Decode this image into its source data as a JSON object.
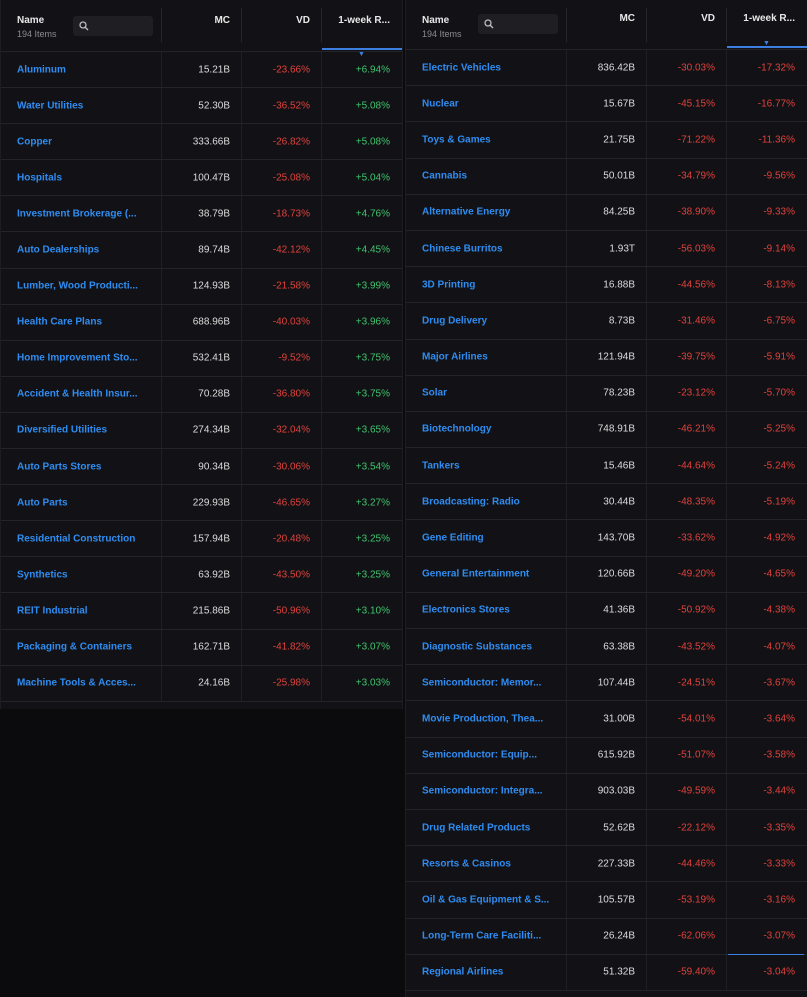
{
  "colors": {
    "accent": "#3d7fe0",
    "positive": "#3ec46d",
    "negative": "#e0413c",
    "link": "#2f8cf0"
  },
  "left": {
    "header": {
      "name": "Name",
      "count": "194 Items",
      "mc": "MC",
      "vd": "VD",
      "week": "1-week R..."
    },
    "rows": [
      {
        "name": "Aluminum",
        "mc": "15.21B",
        "vd": "-23.66%",
        "wk": "+6.94%"
      },
      {
        "name": "Water Utilities",
        "mc": "52.30B",
        "vd": "-36.52%",
        "wk": "+5.08%"
      },
      {
        "name": "Copper",
        "mc": "333.66B",
        "vd": "-26.82%",
        "wk": "+5.08%"
      },
      {
        "name": "Hospitals",
        "mc": "100.47B",
        "vd": "-25.08%",
        "wk": "+5.04%"
      },
      {
        "name": "Investment Brokerage (...",
        "mc": "38.79B",
        "vd": "-18.73%",
        "wk": "+4.76%"
      },
      {
        "name": "Auto Dealerships",
        "mc": "89.74B",
        "vd": "-42.12%",
        "wk": "+4.45%"
      },
      {
        "name": "Lumber, Wood Producti...",
        "mc": "124.93B",
        "vd": "-21.58%",
        "wk": "+3.99%"
      },
      {
        "name": "Health Care Plans",
        "mc": "688.96B",
        "vd": "-40.03%",
        "wk": "+3.96%"
      },
      {
        "name": "Home Improvement Sto...",
        "mc": "532.41B",
        "vd": "-9.52%",
        "wk": "+3.75%"
      },
      {
        "name": "Accident & Health Insur...",
        "mc": "70.28B",
        "vd": "-36.80%",
        "wk": "+3.75%"
      },
      {
        "name": "Diversified Utilities",
        "mc": "274.34B",
        "vd": "-32.04%",
        "wk": "+3.65%"
      },
      {
        "name": "Auto Parts Stores",
        "mc": "90.34B",
        "vd": "-30.06%",
        "wk": "+3.54%"
      },
      {
        "name": "Auto Parts",
        "mc": "229.93B",
        "vd": "-46.65%",
        "wk": "+3.27%"
      },
      {
        "name": "Residential Construction",
        "mc": "157.94B",
        "vd": "-20.48%",
        "wk": "+3.25%"
      },
      {
        "name": "Synthetics",
        "mc": "63.92B",
        "vd": "-43.50%",
        "wk": "+3.25%"
      },
      {
        "name": "REIT Industrial",
        "mc": "215.86B",
        "vd": "-50.96%",
        "wk": "+3.10%"
      },
      {
        "name": "Packaging & Containers",
        "mc": "162.71B",
        "vd": "-41.82%",
        "wk": "+3.07%"
      },
      {
        "name": "Machine Tools & Acces...",
        "mc": "24.16B",
        "vd": "-25.98%",
        "wk": "+3.03%"
      }
    ]
  },
  "right": {
    "header": {
      "name": "Name",
      "count": "194 Items",
      "mc": "MC",
      "vd": "VD",
      "week": "1-week R..."
    },
    "rows": [
      {
        "name": "Electric Vehicles",
        "mc": "836.42B",
        "vd": "-30.03%",
        "wk": "-17.32%"
      },
      {
        "name": "Nuclear",
        "mc": "15.67B",
        "vd": "-45.15%",
        "wk": "-16.77%"
      },
      {
        "name": "Toys & Games",
        "mc": "21.75B",
        "vd": "-71.22%",
        "wk": "-11.36%"
      },
      {
        "name": "Cannabis",
        "mc": "50.01B",
        "vd": "-34.79%",
        "wk": "-9.56%"
      },
      {
        "name": "Alternative Energy",
        "mc": "84.25B",
        "vd": "-38.90%",
        "wk": "-9.33%"
      },
      {
        "name": "Chinese Burritos",
        "mc": "1.93T",
        "vd": "-56.03%",
        "wk": "-9.14%"
      },
      {
        "name": "3D Printing",
        "mc": "16.88B",
        "vd": "-44.56%",
        "wk": "-8.13%"
      },
      {
        "name": "Drug Delivery",
        "mc": "8.73B",
        "vd": "-31.46%",
        "wk": "-6.75%"
      },
      {
        "name": "Major Airlines",
        "mc": "121.94B",
        "vd": "-39.75%",
        "wk": "-5.91%"
      },
      {
        "name": "Solar",
        "mc": "78.23B",
        "vd": "-23.12%",
        "wk": "-5.70%"
      },
      {
        "name": "Biotechnology",
        "mc": "748.91B",
        "vd": "-46.21%",
        "wk": "-5.25%"
      },
      {
        "name": "Tankers",
        "mc": "15.46B",
        "vd": "-44.64%",
        "wk": "-5.24%"
      },
      {
        "name": "Broadcasting: Radio",
        "mc": "30.44B",
        "vd": "-48.35%",
        "wk": "-5.19%"
      },
      {
        "name": "Gene Editing",
        "mc": "143.70B",
        "vd": "-33.62%",
        "wk": "-4.92%"
      },
      {
        "name": "General Entertainment",
        "mc": "120.66B",
        "vd": "-49.20%",
        "wk": "-4.65%"
      },
      {
        "name": "Electronics Stores",
        "mc": "41.36B",
        "vd": "-50.92%",
        "wk": "-4.38%"
      },
      {
        "name": "Diagnostic Substances",
        "mc": "63.38B",
        "vd": "-43.52%",
        "wk": "-4.07%"
      },
      {
        "name": "Semiconductor: Memor...",
        "mc": "107.44B",
        "vd": "-24.51%",
        "wk": "-3.67%"
      },
      {
        "name": "Movie Production, Thea...",
        "mc": "31.00B",
        "vd": "-54.01%",
        "wk": "-3.64%"
      },
      {
        "name": "Semiconductor: Equip...",
        "mc": "615.92B",
        "vd": "-51.07%",
        "wk": "-3.58%"
      },
      {
        "name": "Semiconductor: Integra...",
        "mc": "903.03B",
        "vd": "-49.59%",
        "wk": "-3.44%"
      },
      {
        "name": "Drug Related Products",
        "mc": "52.62B",
        "vd": "-22.12%",
        "wk": "-3.35%"
      },
      {
        "name": "Resorts & Casinos",
        "mc": "227.33B",
        "vd": "-44.46%",
        "wk": "-3.33%"
      },
      {
        "name": "Oil & Gas Equipment & S...",
        "mc": "105.57B",
        "vd": "-53.19%",
        "wk": "-3.16%"
      },
      {
        "name": "Long-Term Care Faciliti...",
        "mc": "26.24B",
        "vd": "-62.06%",
        "wk": "-3.07%"
      },
      {
        "name": "Regional Airlines",
        "mc": "51.32B",
        "vd": "-59.40%",
        "wk": "-3.04%"
      }
    ]
  }
}
